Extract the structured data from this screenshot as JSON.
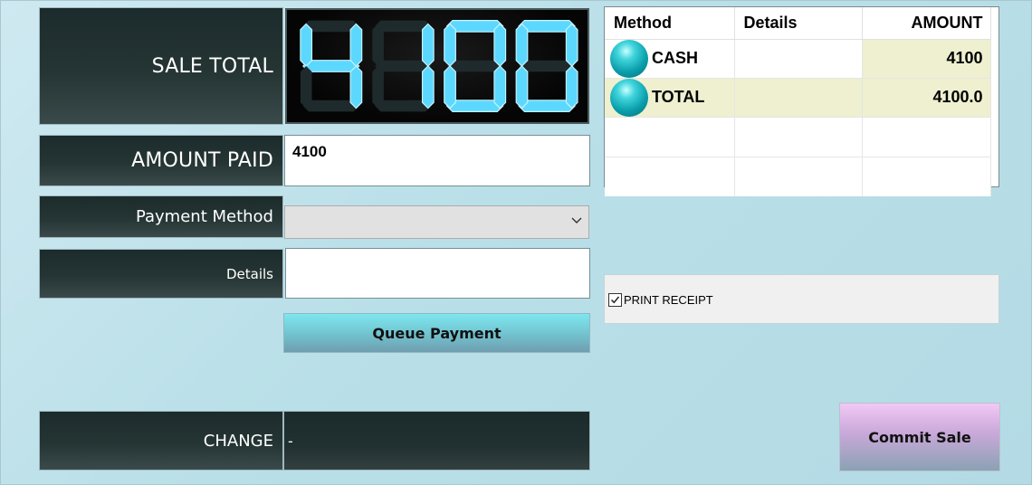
{
  "labels": {
    "sale_total": "SALE TOTAL",
    "amount_paid": "AMOUNT PAID",
    "payment_method": "Payment Method",
    "details": "Details",
    "change": "CHANGE"
  },
  "sale_total_display": "4100",
  "inputs": {
    "amount_paid_value": "4100",
    "payment_method_value": "",
    "details_value": ""
  },
  "change_value": "-",
  "buttons": {
    "queue_payment": "Queue Payment",
    "commit_sale": "Commit Sale"
  },
  "payments_grid": {
    "columns": [
      "Method",
      "Details",
      "AMOUNT"
    ],
    "rows": [
      {
        "method": "CASH",
        "details": "",
        "amount": "4100"
      },
      {
        "method": "TOTAL",
        "details": "",
        "amount": "4100.0"
      }
    ]
  },
  "print_receipt": {
    "label": "PRINT RECEIPT",
    "checked": true
  },
  "colors": {
    "background": "#b9dfe8",
    "label_bg": "#253534",
    "segment_on": "#5cd8ff",
    "highlight_row": "#eef0cf",
    "queue_button": "#73c9d4",
    "commit_button": "#c8a8d8"
  },
  "icons": {
    "payment_row_icon": "teal-ball-icon",
    "dropdown_icon": "chevron-down-icon",
    "checkbox_icon": "check-icon"
  }
}
